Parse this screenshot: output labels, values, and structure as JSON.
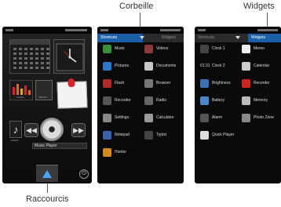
{
  "callouts": {
    "corbeille": "Corbeille",
    "widgets": "Widgets",
    "raccourcis": "Raccourcis"
  },
  "home_screen": {
    "music_player_title": "Music Player",
    "tiny_labels": {
      "flash": "FLASH",
      "photo": "PHOTO",
      "music": "MUSIC"
    },
    "colors": {
      "memo_pin": "#d8232a",
      "shortcut_arrow": "#4aa3ff"
    }
  },
  "shortcuts_screen": {
    "tabs": {
      "shortcuts": "Shortcuts",
      "widgets": "Widgets"
    },
    "items": [
      {
        "label": "Music",
        "icon": "music-note-icon",
        "color": "#3a8f3a"
      },
      {
        "label": "Videos",
        "icon": "film-icon",
        "color": "#8a3a3a"
      },
      {
        "label": "Pictures",
        "icon": "picture-icon",
        "color": "#2f78c9"
      },
      {
        "label": "Documents",
        "icon": "document-icon",
        "color": "#c9c9c9"
      },
      {
        "label": "Flash",
        "icon": "flash-icon",
        "color": "#b02a2a"
      },
      {
        "label": "Browser",
        "icon": "globe-icon",
        "color": "#777777"
      },
      {
        "label": "Recorder",
        "icon": "recorder-icon",
        "color": "#555555"
      },
      {
        "label": "Radio",
        "icon": "radio-icon",
        "color": "#666666"
      },
      {
        "label": "Settings",
        "icon": "gear-icon",
        "color": "#888888"
      },
      {
        "label": "Calculator",
        "icon": "calculator-icon",
        "color": "#999999"
      },
      {
        "label": "Notepad",
        "icon": "notepad-icon",
        "color": "#3a62a8"
      },
      {
        "label": "Typist",
        "icon": "typist-icon",
        "color": "#444444"
      },
      {
        "label": "Hunter",
        "icon": "hunter-icon",
        "color": "#d48a1e"
      }
    ]
  },
  "widgets_screen": {
    "tabs": {
      "shortcuts": "Shortcuts",
      "widgets": "Widgets"
    },
    "items": [
      {
        "label": "Clock 1",
        "icon": "clock-icon",
        "color": "#444444"
      },
      {
        "label": "Memo",
        "icon": "memo-icon",
        "color": "#eeeeee"
      },
      {
        "label": "Clock 2",
        "icon": "digital-clock-icon",
        "color": "#222222",
        "glyph": "01:31"
      },
      {
        "label": "Calendar",
        "icon": "calendar-icon",
        "color": "#cccccc"
      },
      {
        "label": "Brightness",
        "icon": "car-icon",
        "color": "#3a6fb0"
      },
      {
        "label": "Recorder",
        "icon": "recorder-icon",
        "color": "#cc2222"
      },
      {
        "label": "Battery",
        "icon": "battery-icon",
        "color": "#4a86c8"
      },
      {
        "label": "Memory",
        "icon": "memory-icon",
        "color": "#bbbbbb"
      },
      {
        "label": "Alarm",
        "icon": "alarm-icon",
        "color": "#555555"
      },
      {
        "label": "Photo Zone",
        "icon": "photo-zone-icon",
        "color": "#888888"
      },
      {
        "label": "Quick Player",
        "icon": "quick-player-icon",
        "color": "#dddddd"
      }
    ]
  }
}
